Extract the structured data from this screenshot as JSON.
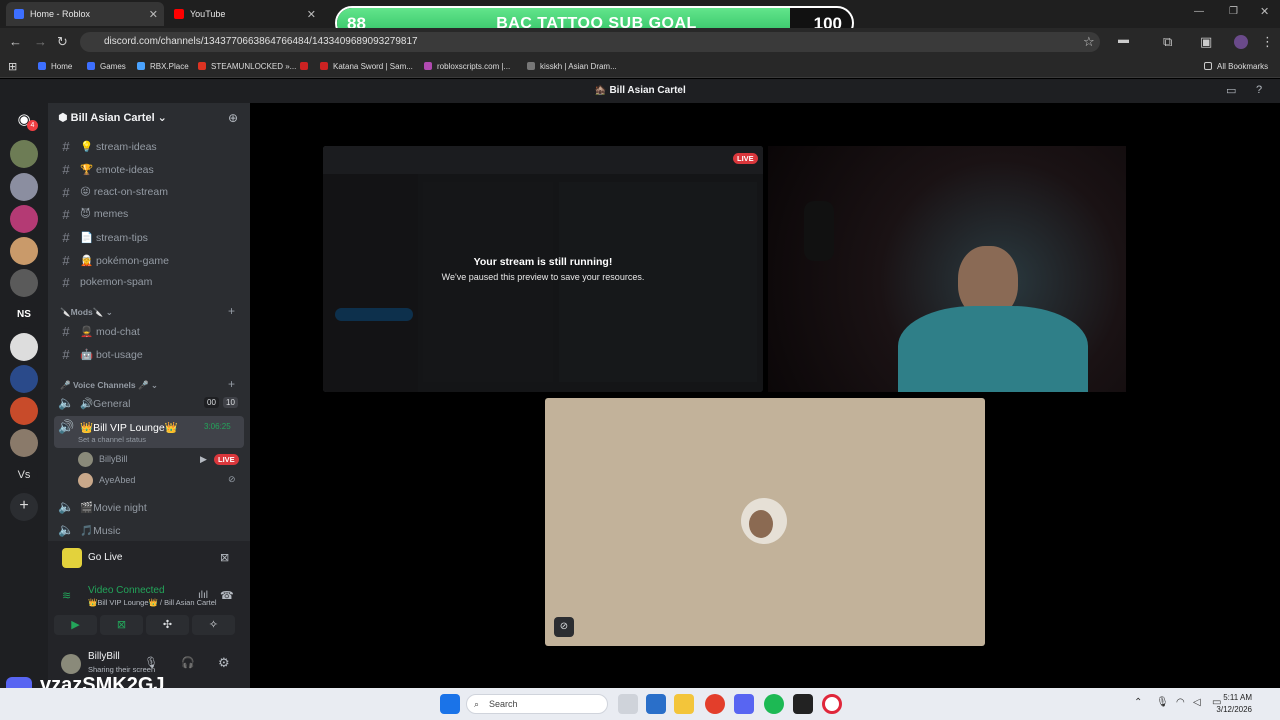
{
  "browser": {
    "tabs": [
      {
        "label": "Home - Roblox"
      },
      {
        "label": "YouTube"
      }
    ],
    "url": "discord.com/channels/1343770663864766484/1433409689093279817",
    "bookmarks": [
      "Home",
      "Games",
      "RBX.Place",
      "STEAMUNLOCKED »...",
      "Katana Sword | Sam...",
      "robloxscripts.com |...",
      "kisskh | Asian Dram..."
    ],
    "all_bookmarks": "All Bookmarks"
  },
  "overlay": {
    "start": "88",
    "title": "BAC TATTOO SUB GOAL",
    "end": "100",
    "progress": 0.88
  },
  "discord": {
    "window_title": "Bill Asian Cartel",
    "server_name": "Bill Asian Cartel",
    "text_channels": [
      "💡 stream-ideas",
      "🏆 emote-ideas",
      "😝 react-on-stream",
      "😈 memes",
      "📄 stream-tips",
      "🧝 pokémon-game",
      "pokemon-spam"
    ],
    "mods_category": "🔪Mods🔪",
    "mod_channels": [
      "💂 mod-chat",
      "🤖 bot-usage"
    ],
    "voice_category": "🎤 Voice Channels 🎤",
    "voice_channels": {
      "general": "🔊General",
      "general_count_a": "00",
      "general_count_b": "10",
      "vip": "👑Bill VIP Lounge👑",
      "vip_timer": "3:06:25",
      "vip_status": "Set a channel status",
      "movie": "🎬Movie night",
      "music": "🎵Music"
    },
    "members": [
      {
        "name": "BillyBill",
        "badge": "LIVE"
      },
      {
        "name": "AyeAbed"
      }
    ],
    "go_live": "Go Live",
    "voice_status": "Video Connected",
    "voice_location": "👑Bill VIP Lounge👑 / Bill Asian Cartel",
    "user": {
      "name": "BillyBill",
      "status": "Sharing their screen"
    },
    "watermark": "vzazSMK2GJ"
  },
  "stream": {
    "live_badge": "LIVE",
    "paused_title": "Your stream is still running!",
    "paused_sub": "We've paused this preview to save your resources."
  },
  "taskbar": {
    "search": "Search",
    "time": "5:11 AM",
    "date": "3/12/2026"
  }
}
